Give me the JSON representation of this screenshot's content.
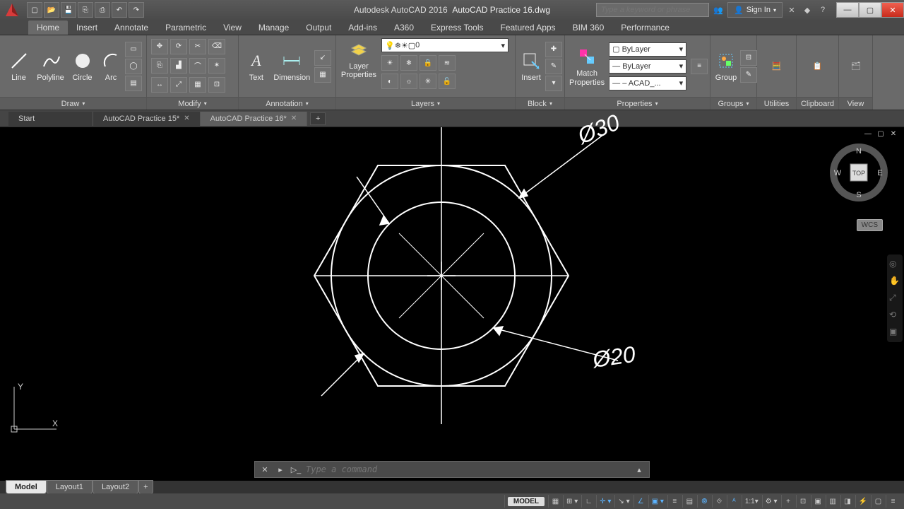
{
  "app": {
    "name": "Autodesk AutoCAD 2016",
    "document": "AutoCAD Practice 16.dwg"
  },
  "search": {
    "placeholder": "Type a keyword or phrase"
  },
  "signin": {
    "label": "Sign In"
  },
  "ribbonTabs": [
    "Home",
    "Insert",
    "Annotate",
    "Parametric",
    "View",
    "Manage",
    "Output",
    "Add-ins",
    "A360",
    "Express Tools",
    "Featured Apps",
    "BIM 360",
    "Performance"
  ],
  "panels": {
    "draw": {
      "title": "Draw",
      "line": "Line",
      "polyline": "Polyline",
      "circle": "Circle",
      "arc": "Arc"
    },
    "modify": {
      "title": "Modify"
    },
    "annotation": {
      "title": "Annotation",
      "text": "Text",
      "dimension": "Dimension"
    },
    "layers": {
      "title": "Layers",
      "btn": "Layer\nProperties",
      "current": "0"
    },
    "block": {
      "title": "Block",
      "insert": "Insert"
    },
    "properties": {
      "title": "Properties",
      "match": "Match\nProperties",
      "bylayer": "ByLayer",
      "lt": "— ByLayer",
      "lw": "— – ACAD_..."
    },
    "groups": {
      "title": "Groups",
      "group": "Group"
    },
    "utilities": {
      "title": "Utilities"
    },
    "clipboard": {
      "title": "Clipboard"
    },
    "view": {
      "title": "View"
    }
  },
  "docTabs": {
    "start": "Start",
    "t1": "AutoCAD Practice 15*",
    "t2": "AutoCAD Practice 16*"
  },
  "drawing": {
    "dia1": "Ø30",
    "dia2": "Ø20"
  },
  "viewcube": {
    "top": "TOP",
    "n": "N",
    "e": "E",
    "s": "S",
    "w": "W"
  },
  "wcs": "WCS",
  "ucs": {
    "x": "X",
    "y": "Y"
  },
  "cmd": {
    "placeholder": "Type a command"
  },
  "layoutTabs": {
    "model": "Model",
    "l1": "Layout1",
    "l2": "Layout2"
  },
  "status": {
    "model": "MODEL",
    "scale": "1:1"
  }
}
